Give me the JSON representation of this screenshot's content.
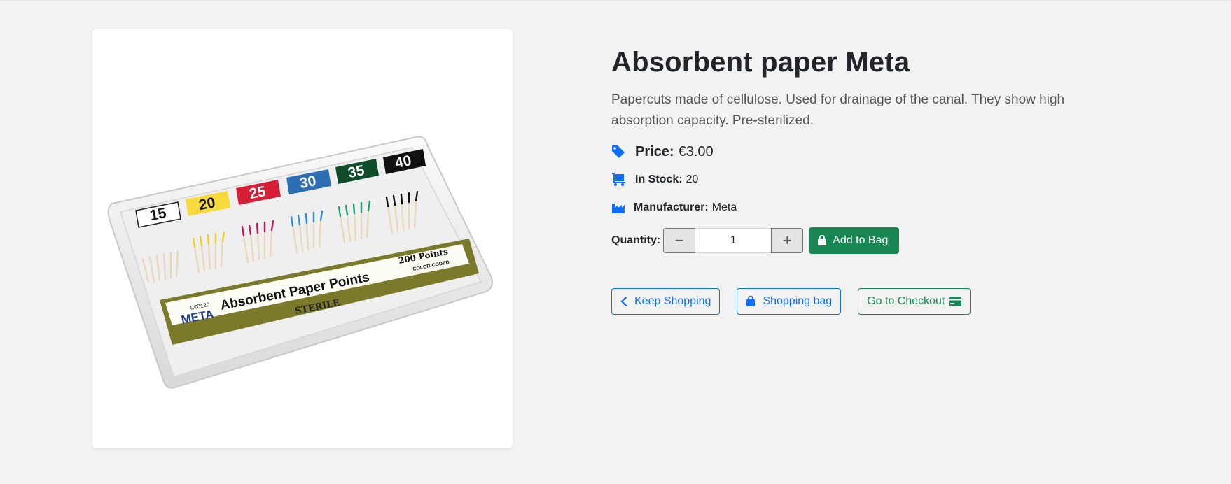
{
  "product": {
    "title": "Absorbent paper Meta",
    "description": "Papercuts made of cellulose. Used for drainage of the canal. They show high absorption capacity. Pre-sterilized.",
    "price_label": "Price:",
    "price_value": "€3.00",
    "stock_label": "In Stock:",
    "stock_value": "20",
    "manufacturer_label": "Manufacturer:",
    "manufacturer_value": "Meta",
    "image": {
      "box_sizes": [
        "15",
        "20",
        "25",
        "30",
        "35",
        "40"
      ],
      "brand": "META",
      "ce_mark": "C€0120",
      "product_name": "Absorbent Paper Points",
      "count": "200 Points",
      "coding": "COLOR-CODED",
      "sterile": "STERILE"
    }
  },
  "quantity": {
    "label": "Quantity:",
    "value": "1",
    "decrement_symbol": "−",
    "increment_symbol": "+"
  },
  "actions": {
    "add_to_bag": "Add to Bag",
    "keep_shopping": "Keep Shopping",
    "shopping_bag": "Shopping bag",
    "checkout": "Go to Checkout"
  },
  "icons": {
    "price": "tag-icon",
    "stock": "dolly-icon",
    "manufacturer": "industry-icon",
    "add": "bag-icon",
    "keep": "chevron-left-icon",
    "bag": "bag-icon",
    "checkout": "credit-card-icon"
  },
  "colors": {
    "primary": "#0d6efd",
    "success": "#198754",
    "background": "#f2f2f2"
  }
}
